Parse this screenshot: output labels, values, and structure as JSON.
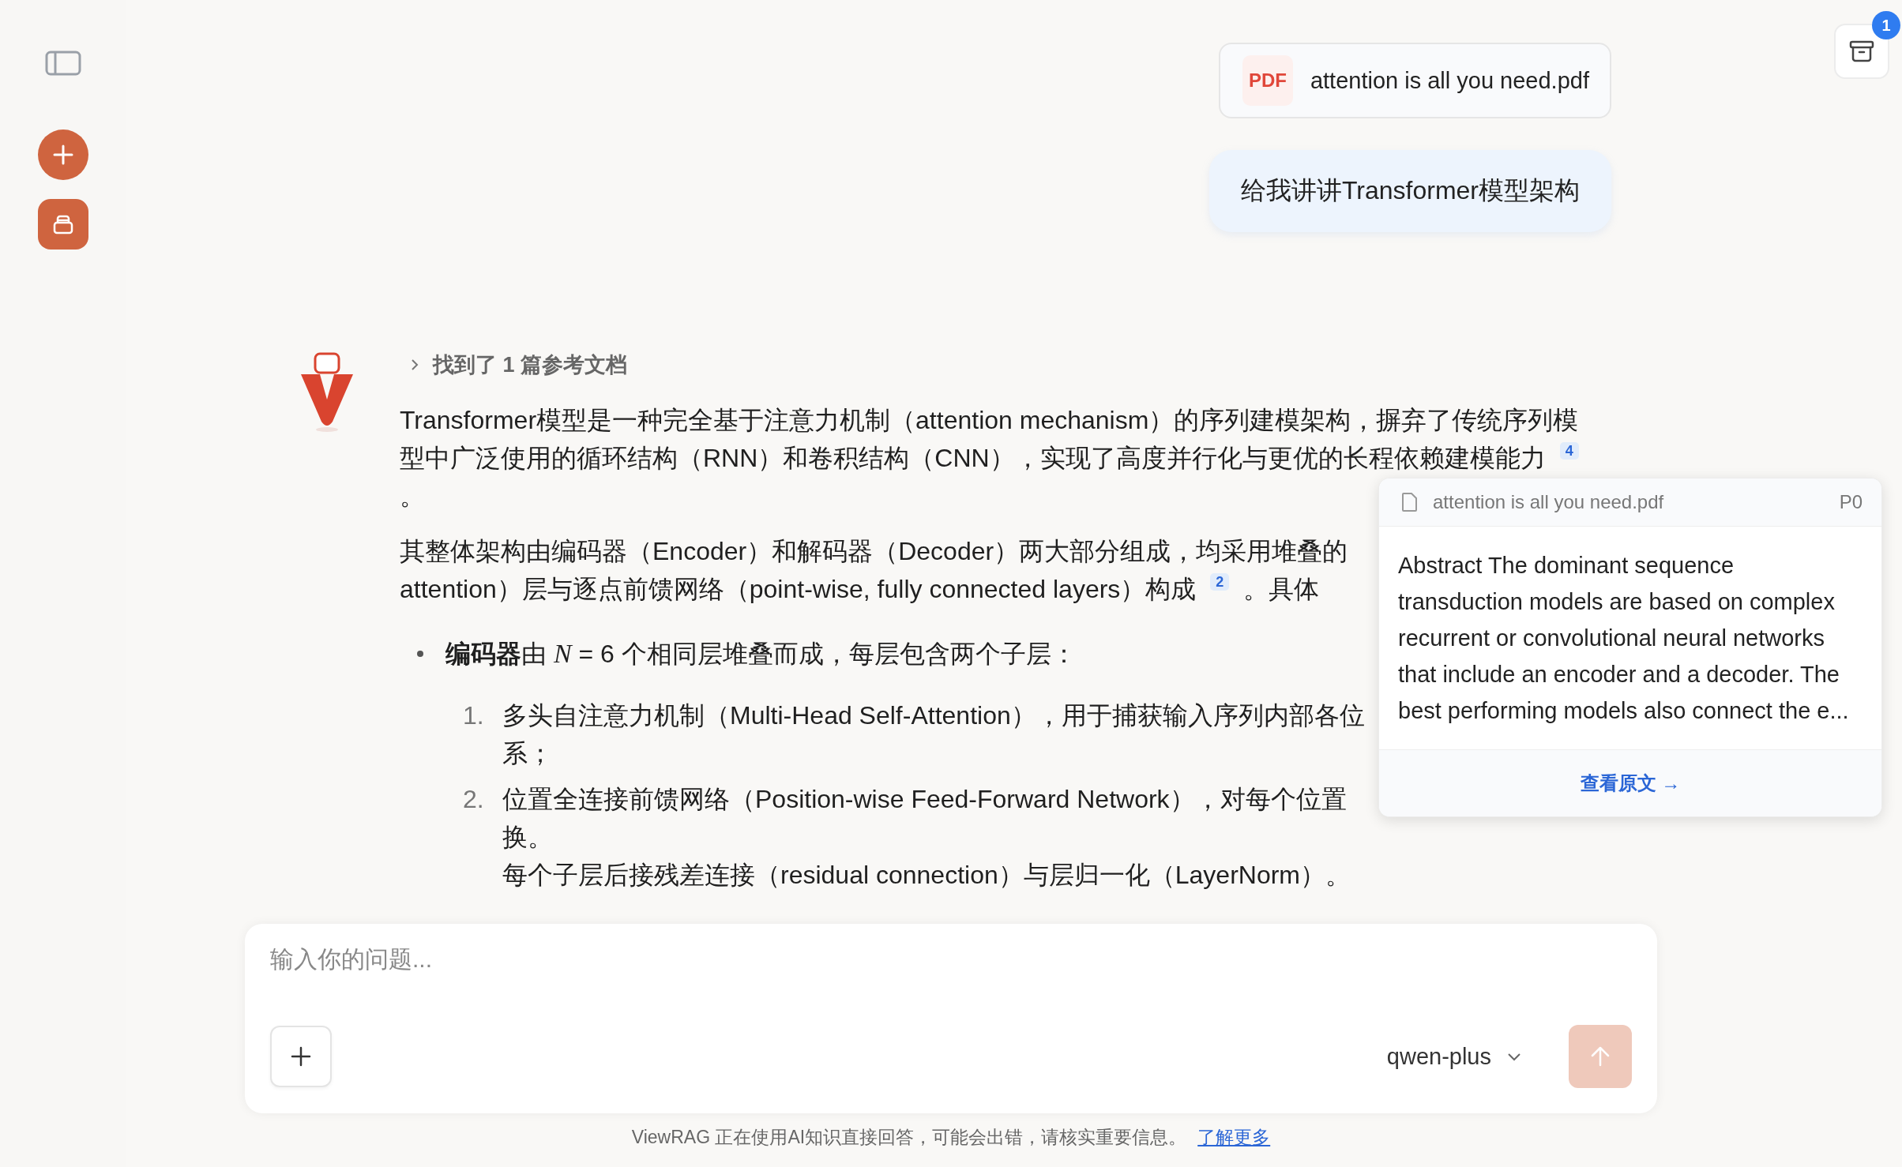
{
  "archive_button": {
    "badge": "1"
  },
  "messages": [
    {
      "kind": "file",
      "badge": "PDF",
      "name": "attention is all you need.pdf"
    },
    {
      "kind": "user",
      "text": "给我讲讲Transformer模型架构"
    }
  ],
  "answer": {
    "references": {
      "label": "找到了 1 篇参考文档",
      "expanded": false
    },
    "blocks": [
      {
        "kind": "paragraph",
        "lines": [
          {
            "text": "Transformer模型是一种完全基于注意力机制（attention mechanism）的序列建模架构，摒弃了传统序列模"
          },
          {
            "text": "型中广泛使用的循环结构（RNN）和卷积结构（CNN），实现了高度并行化与更优的长程依赖建模能力",
            "citation": "4"
          },
          {
            "text": "。"
          }
        ]
      },
      {
        "kind": "paragraph",
        "lines": [
          {
            "text": "其整体架构由编码器（Encoder）和解码器（Decoder）两大部分组成，均采用堆叠的"
          },
          {
            "text": "attention）层与逐点前馈网络（point-wise, fully connected layers）构成",
            "citation": "2",
            "after": "。具体"
          }
        ]
      },
      {
        "kind": "bullet",
        "lines": [
          {
            "text": "**编码器**由 *N* = 6 个相同层堆叠而成，每层包含两个子层："
          }
        ],
        "children": [
          {
            "number": "1.",
            "lines": [
              {
                "text": "多头自注意力机制（Multi-Head Self-Attention），用于捕获输入序列内部各位"
              },
              {
                "text": "系；"
              }
            ]
          },
          {
            "number": "2.",
            "lines": [
              {
                "text": "位置全连接前馈网络（Position-wise Feed-Forward Network），对每个位置"
              },
              {
                "text": "换。"
              },
              {
                "text": "每个子层后接残差连接（residual connection）与层归一化（LayerNorm）。"
              }
            ]
          }
        ]
      }
    ]
  },
  "popup": {
    "file": "attention is all you need.pdf",
    "page": "P0",
    "excerpt": "Abstract The dominant sequence transduction models are based on complex recurrent or convolutional neural networks that include an encoder and a decoder. The best performing models also connect the e...",
    "link": "查看原文 →"
  },
  "composer": {
    "placeholder": "输入你的问题...",
    "model": "qwen-plus",
    "send_disabled": true
  },
  "footer": {
    "note": "ViewRAG 正在使用AI知识直接回答，可能会出错，请核实重要信息。",
    "link": "了解更多"
  }
}
